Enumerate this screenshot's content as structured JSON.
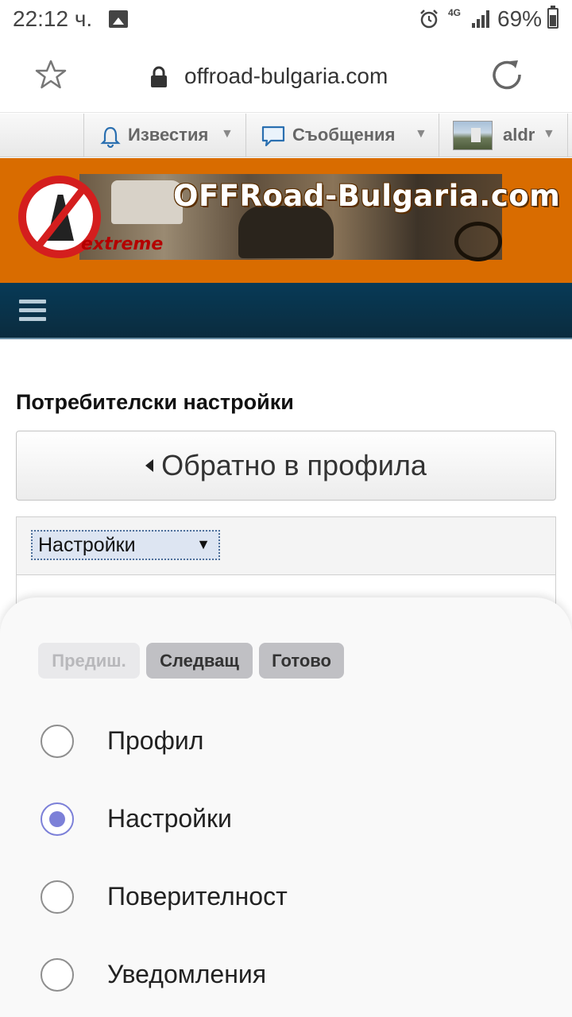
{
  "status_bar": {
    "time": "22:12 ч.",
    "network": "4G",
    "battery_percent": "69%",
    "icons": [
      "image-icon",
      "alarm-icon",
      "signal-icon",
      "battery-icon"
    ]
  },
  "browser": {
    "url": "offroad-bulgaria.com",
    "icons": [
      "star-icon",
      "lock-icon",
      "reload-icon"
    ]
  },
  "forum_bar": {
    "notifications_label": "Известия",
    "messages_label": "Съобщения",
    "username": "aldr",
    "dropdown_glyph": "▼"
  },
  "banner": {
    "title": "OFFRoad-Bulgaria.com",
    "tagline": "extreme"
  },
  "page": {
    "title": "Потребителски настройки",
    "back_button_label": "Обратно в профила",
    "selected_section": "Настройки",
    "select_arrow": "▼"
  },
  "picker": {
    "prev_label": "Предиш.",
    "next_label": "Следващ",
    "done_label": "Готово",
    "options": [
      {
        "label": "Профил",
        "selected": false
      },
      {
        "label": "Настройки",
        "selected": true
      },
      {
        "label": "Поверителност",
        "selected": false
      },
      {
        "label": "Уведомления",
        "selected": false
      }
    ]
  },
  "colors": {
    "banner_orange": "#d96c00",
    "nav_blue": "#073a57",
    "radio_accent": "#7c80d8"
  }
}
